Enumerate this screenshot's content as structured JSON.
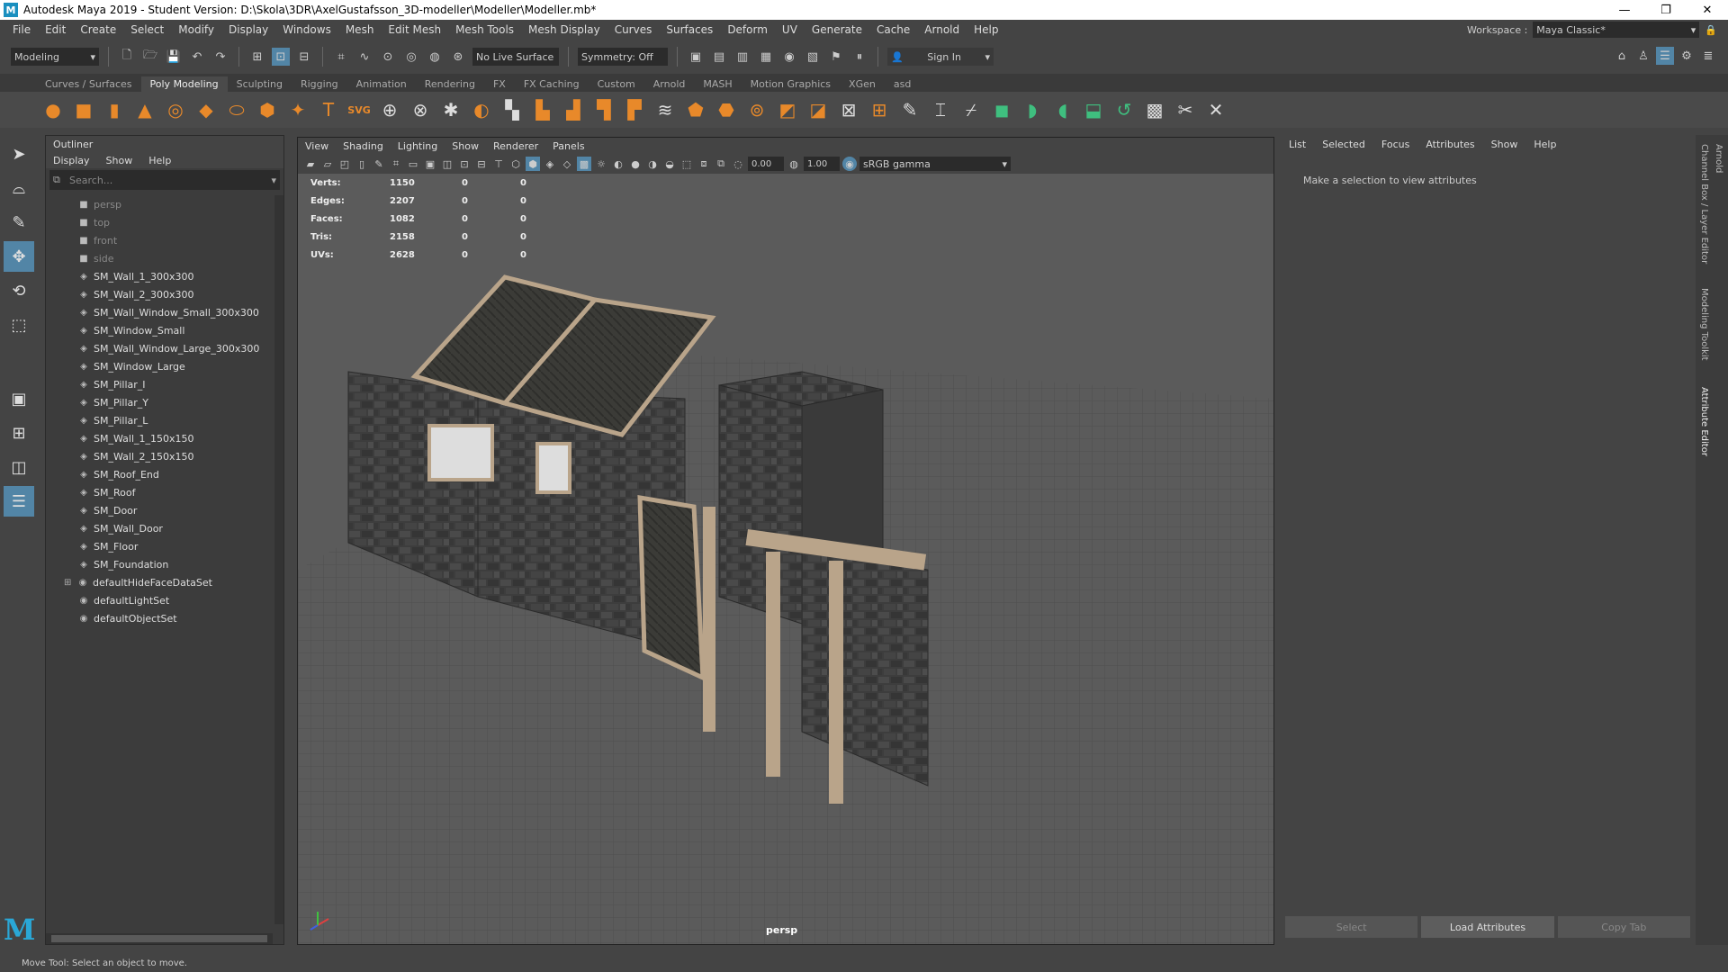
{
  "titlebar": {
    "title": "Autodesk Maya 2019 - Student Version: D:\\Skola\\3DR\\AxelGustafsson_3D-modeller\\Modeller\\Modeller.mb*",
    "logo": "M",
    "minimize": "—",
    "restore": "❐",
    "close": "✕"
  },
  "menubar": {
    "items": [
      "File",
      "Edit",
      "Create",
      "Select",
      "Modify",
      "Display",
      "Windows",
      "Mesh",
      "Edit Mesh",
      "Mesh Tools",
      "Mesh Display",
      "Curves",
      "Surfaces",
      "Deform",
      "UV",
      "Generate",
      "Cache",
      "Arnold",
      "Help"
    ],
    "workspace_label": "Workspace :",
    "workspace_value": "Maya Classic*"
  },
  "statusline": {
    "menuset": "Modeling",
    "live_surface": "No Live Surface",
    "symmetry": "Symmetry: Off",
    "sign_in": "Sign In"
  },
  "shelf": {
    "tabs": [
      "Curves / Surfaces",
      "Poly Modeling",
      "Sculpting",
      "Rigging",
      "Animation",
      "Rendering",
      "FX",
      "FX Caching",
      "Custom",
      "Arnold",
      "MASH",
      "Motion Graphics",
      "XGen",
      "asd"
    ],
    "active_tab": "Poly Modeling"
  },
  "outliner": {
    "title": "Outliner",
    "menu": [
      "Display",
      "Show",
      "Help"
    ],
    "search_placeholder": "Search...",
    "cameras": [
      "persp",
      "top",
      "front",
      "side"
    ],
    "meshes": [
      "SM_Wall_1_300x300",
      "SM_Wall_2_300x300",
      "SM_Wall_Window_Small_300x300",
      "SM_Window_Small",
      "SM_Wall_Window_Large_300x300",
      "SM_Window_Large",
      "SM_Pillar_I",
      "SM_Pillar_Y",
      "SM_Pillar_L",
      "SM_Wall_1_150x150",
      "SM_Wall_2_150x150",
      "SM_Roof_End",
      "SM_Roof",
      "SM_Door",
      "SM_Wall_Door",
      "SM_Floor",
      "SM_Foundation"
    ],
    "sets": [
      "defaultHideFaceDataSet",
      "defaultLightSet",
      "defaultObjectSet"
    ]
  },
  "viewport": {
    "menu": [
      "View",
      "Shading",
      "Lighting",
      "Show",
      "Renderer",
      "Panels"
    ],
    "exposure": "0.00",
    "gamma": "1.00",
    "color_space": "sRGB gamma",
    "camera": "persp",
    "hud": [
      {
        "label": "Verts:",
        "value": "1150",
        "a": "0",
        "b": "0"
      },
      {
        "label": "Edges:",
        "value": "2207",
        "a": "0",
        "b": "0"
      },
      {
        "label": "Faces:",
        "value": "1082",
        "a": "0",
        "b": "0"
      },
      {
        "label": "Tris:",
        "value": "2158",
        "a": "0",
        "b": "0"
      },
      {
        "label": "UVs:",
        "value": "2628",
        "a": "0",
        "b": "0"
      }
    ]
  },
  "attribute_editor": {
    "menu": [
      "List",
      "Selected",
      "Focus",
      "Attributes",
      "Show",
      "Help"
    ],
    "message": "Make a selection to view attributes",
    "buttons": [
      "Select",
      "Load Attributes",
      "Copy Tab"
    ]
  },
  "side_tabs": [
    "Channel Box / Layer Editor",
    "Modeling Toolkit",
    "Attribute Editor"
  ],
  "side_tabs_extra": "Arnold",
  "helpline": "Move Tool: Select an object to move.",
  "colors": {
    "accent": "#5285a6",
    "shelf_orange": "#e8892a",
    "shelf_green": "#3fbf7f"
  }
}
